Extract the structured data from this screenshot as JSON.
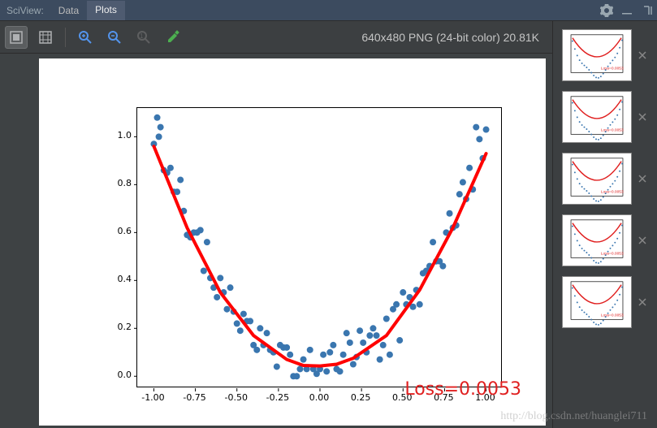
{
  "header": {
    "title": "SciView:",
    "tabs": [
      {
        "label": "Data",
        "active": false
      },
      {
        "label": "Plots",
        "active": true
      }
    ]
  },
  "toolbar": {
    "image_info": "640x480 PNG (24-bit color) 20.81K"
  },
  "chart_data": {
    "type": "scatter+line",
    "title": "",
    "xlabel": "",
    "ylabel": "",
    "xlim": [
      -1.1,
      1.1
    ],
    "ylim": [
      -0.05,
      1.12
    ],
    "xticks": [
      -1.0,
      -0.75,
      -0.5,
      -0.25,
      0.0,
      0.25,
      0.5,
      0.75,
      1.0
    ],
    "yticks": [
      0.0,
      0.2,
      0.4,
      0.6,
      0.8,
      1.0
    ],
    "annotation": "Loss=0.0053",
    "series": [
      {
        "name": "scatter",
        "type": "scatter",
        "color": "#3a76af",
        "x": [
          -1.0,
          -0.98,
          -0.97,
          -0.96,
          -0.94,
          -0.92,
          -0.9,
          -0.88,
          -0.86,
          -0.84,
          -0.82,
          -0.8,
          -0.78,
          -0.76,
          -0.74,
          -0.72,
          -0.7,
          -0.68,
          -0.66,
          -0.64,
          -0.62,
          -0.6,
          -0.58,
          -0.56,
          -0.54,
          -0.52,
          -0.5,
          -0.48,
          -0.46,
          -0.44,
          -0.42,
          -0.4,
          -0.38,
          -0.36,
          -0.34,
          -0.32,
          -0.3,
          -0.28,
          -0.26,
          -0.24,
          -0.22,
          -0.2,
          -0.18,
          -0.16,
          -0.14,
          -0.12,
          -0.1,
          -0.08,
          -0.06,
          -0.04,
          -0.02,
          0.0,
          0.02,
          0.04,
          0.06,
          0.08,
          0.1,
          0.12,
          0.14,
          0.16,
          0.18,
          0.2,
          0.22,
          0.24,
          0.26,
          0.28,
          0.3,
          0.32,
          0.34,
          0.36,
          0.38,
          0.4,
          0.42,
          0.44,
          0.46,
          0.48,
          0.5,
          0.52,
          0.54,
          0.56,
          0.58,
          0.6,
          0.62,
          0.64,
          0.66,
          0.68,
          0.7,
          0.72,
          0.74,
          0.76,
          0.78,
          0.8,
          0.82,
          0.84,
          0.86,
          0.88,
          0.9,
          0.92,
          0.94,
          0.96,
          0.98,
          1.0
        ],
        "y": [
          0.97,
          1.08,
          1.0,
          1.04,
          0.86,
          0.85,
          0.87,
          0.77,
          0.77,
          0.82,
          0.69,
          0.59,
          0.58,
          0.6,
          0.6,
          0.61,
          0.44,
          0.56,
          0.41,
          0.37,
          0.33,
          0.41,
          0.35,
          0.28,
          0.37,
          0.27,
          0.22,
          0.19,
          0.26,
          0.23,
          0.23,
          0.13,
          0.11,
          0.2,
          0.13,
          0.18,
          0.11,
          0.1,
          0.04,
          0.13,
          0.12,
          0.12,
          0.09,
          0.0,
          0.0,
          0.03,
          0.07,
          0.03,
          0.11,
          0.03,
          0.01,
          0.03,
          0.09,
          0.02,
          0.1,
          0.13,
          0.03,
          0.02,
          0.09,
          0.18,
          0.14,
          0.05,
          0.08,
          0.19,
          0.14,
          0.1,
          0.17,
          0.2,
          0.17,
          0.07,
          0.13,
          0.24,
          0.09,
          0.28,
          0.3,
          0.15,
          0.35,
          0.3,
          0.33,
          0.29,
          0.36,
          0.3,
          0.43,
          0.44,
          0.46,
          0.56,
          0.48,
          0.48,
          0.46,
          0.6,
          0.68,
          0.62,
          0.63,
          0.76,
          0.81,
          0.74,
          0.87,
          0.78,
          1.04,
          0.99,
          0.91,
          1.03
        ]
      },
      {
        "name": "fit",
        "type": "line",
        "color": "#ff0000",
        "x": [
          -1.0,
          -0.8,
          -0.6,
          -0.4,
          -0.2,
          -0.1,
          0.0,
          0.1,
          0.2,
          0.4,
          0.6,
          0.8,
          1.0
        ],
        "y": [
          0.96,
          0.62,
          0.35,
          0.17,
          0.07,
          0.045,
          0.043,
          0.05,
          0.075,
          0.17,
          0.36,
          0.62,
          0.93
        ]
      }
    ]
  },
  "thumbnails": {
    "count": 5,
    "current_index": 0
  },
  "watermark": "http://blog.csdn.net/huanglei711"
}
